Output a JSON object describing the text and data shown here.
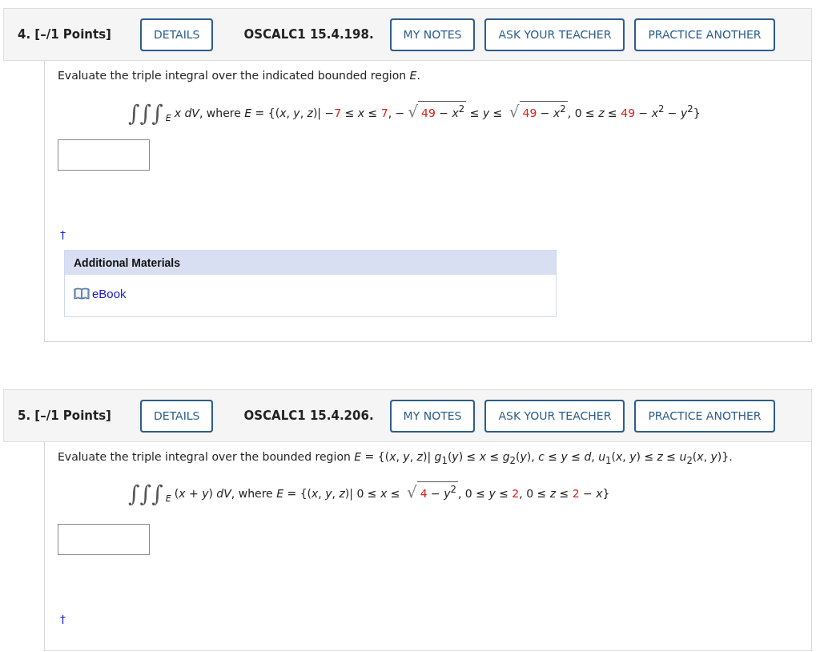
{
  "questions": [
    {
      "header": {
        "points": "4. [–/1 Points]",
        "details": "DETAILS",
        "code": "OSCALC1 15.4.198.",
        "actions": [
          "MY NOTES",
          "ASK YOUR TEACHER",
          "PRACTICE ANOTHER"
        ]
      },
      "prompt": "Evaluate the triple integral over the indicated bounded region *E*.",
      "formula": [
        {
          "kind": "integral",
          "sign": "∫∫∫",
          "sub": "E"
        },
        {
          "kind": "text",
          "text": "*x dV*, where *E* = {(*x*, *y*, *z*)| −"
        },
        {
          "kind": "value",
          "text": "7"
        },
        {
          "kind": "text",
          "text": " ≤ *x* ≤ "
        },
        {
          "kind": "value",
          "text": "7"
        },
        {
          "kind": "text",
          "text": ", −"
        },
        {
          "kind": "sqrt",
          "sign": "√",
          "parts": [
            {
              "kind": "value",
              "text": "49"
            },
            {
              "kind": "text",
              "text": " − *x*$^{2}$"
            }
          ]
        },
        {
          "kind": "text",
          "text": " ≤ *y* ≤ "
        },
        {
          "kind": "sqrt",
          "sign": "√",
          "parts": [
            {
              "kind": "value",
              "text": "49"
            },
            {
              "kind": "text",
              "text": " − *x*$^{2}$"
            }
          ]
        },
        {
          "kind": "text",
          "text": ", 0 ≤ *z* ≤ "
        },
        {
          "kind": "value",
          "text": "49"
        },
        {
          "kind": "text",
          "text": " − *x*$^{2}$ − *y*$^{2}$}"
        }
      ],
      "dagger": "†",
      "materials": {
        "title": "Additional Materials",
        "links": [
          "eBook"
        ]
      }
    },
    {
      "header": {
        "points": "5. [–/1 Points]",
        "details": "DETAILS",
        "code": "OSCALC1 15.4.206.",
        "actions": [
          "MY NOTES",
          "ASK YOUR TEACHER",
          "PRACTICE ANOTHER"
        ]
      },
      "prompt": "Evaluate the triple integral over the bounded region *E* = {(*x*, *y*, *z*)| *g*$_{1}$(*y*) ≤ *x* ≤ *g*$_{2}$(*y*), *c* ≤ *y* ≤ *d*, *u*$_{1}$(*x*, *y*) ≤ *z* ≤ *u*$_{2}$(*x*, *y*)}.",
      "formula": [
        {
          "kind": "integral",
          "sign": "∫∫∫",
          "sub": "E"
        },
        {
          "kind": "text",
          "text": "(*x* + *y*) *dV*, where *E* = {(*x*, *y*, *z*)| 0 ≤ *x* ≤ "
        },
        {
          "kind": "sqrt",
          "sign": "√",
          "parts": [
            {
              "kind": "value",
              "text": "4"
            },
            {
              "kind": "text",
              "text": " − *y*$^{2}$"
            }
          ]
        },
        {
          "kind": "text",
          "text": ", 0 ≤ *y* ≤ "
        },
        {
          "kind": "value",
          "text": "2"
        },
        {
          "kind": "text",
          "text": ", 0 ≤ *z* ≤ "
        },
        {
          "kind": "value",
          "text": "2"
        },
        {
          "kind": "text",
          "text": " − *x*}"
        }
      ],
      "dagger": "†"
    }
  ]
}
